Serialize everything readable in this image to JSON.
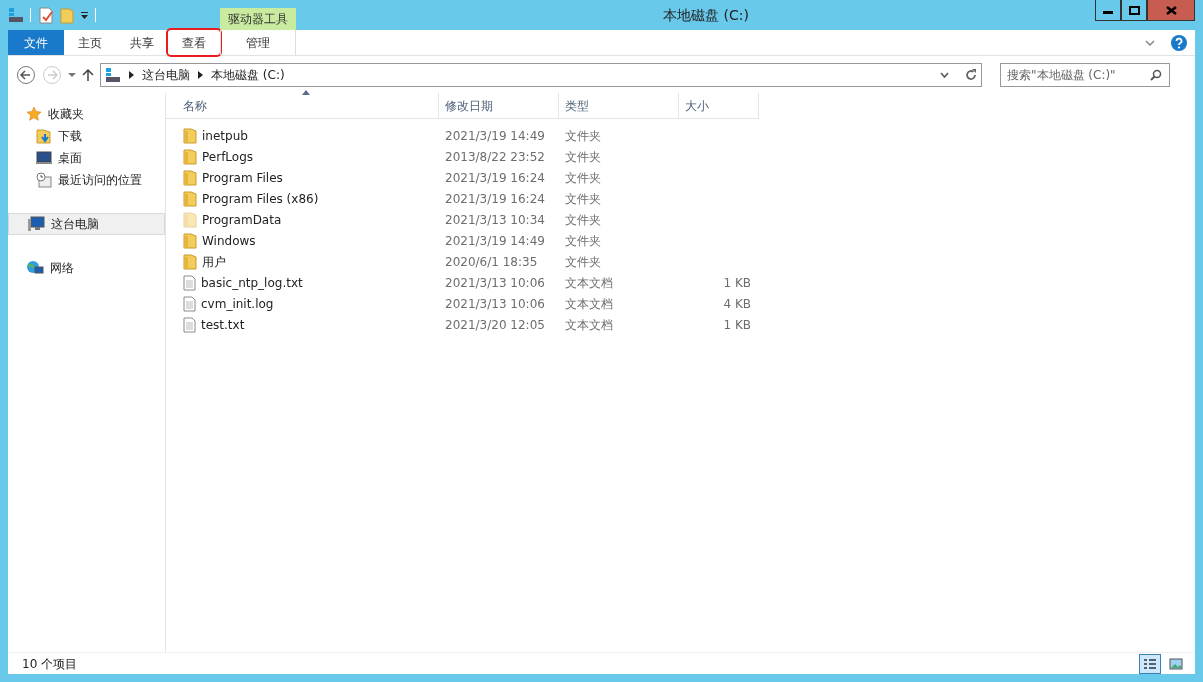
{
  "window": {
    "title": "本地磁盘 (C:)"
  },
  "ribbon": {
    "context_group": "驱动器工具",
    "tabs": [
      {
        "label": "文件",
        "kind": "file",
        "selected": false,
        "highlighted": false
      },
      {
        "label": "主页",
        "kind": "tab",
        "selected": false,
        "highlighted": false
      },
      {
        "label": "共享",
        "kind": "tab",
        "selected": false,
        "highlighted": false
      },
      {
        "label": "查看",
        "kind": "tab",
        "selected": false,
        "highlighted": true
      },
      {
        "label": "管理",
        "kind": "context",
        "selected": false,
        "highlighted": false
      }
    ]
  },
  "address": {
    "breadcrumbs": [
      "这台电脑",
      "本地磁盘 (C:)"
    ]
  },
  "search": {
    "placeholder": "搜索\"本地磁盘 (C:)\""
  },
  "sidebar": {
    "groups": [
      {
        "label": "收藏夹",
        "kind": "star",
        "selected": false,
        "children": [
          {
            "label": "下载",
            "kind": "download"
          },
          {
            "label": "桌面",
            "kind": "desktop"
          },
          {
            "label": "最近访问的位置",
            "kind": "recent"
          }
        ]
      },
      {
        "label": "这台电脑",
        "kind": "computer",
        "selected": true
      },
      {
        "label": "网络",
        "kind": "network",
        "selected": false
      }
    ]
  },
  "table": {
    "columns": [
      {
        "label": "名称",
        "sorted": true
      },
      {
        "label": "修改日期",
        "sorted": false
      },
      {
        "label": "类型",
        "sorted": false
      },
      {
        "label": "大小",
        "sorted": false
      }
    ],
    "rows": [
      {
        "kind": "folder",
        "hidden": false,
        "name": "inetpub",
        "date": "2021/3/19 14:49",
        "type": "文件夹"
      },
      {
        "kind": "folder",
        "hidden": false,
        "name": "PerfLogs",
        "date": "2013/8/22 23:52",
        "type": "文件夹"
      },
      {
        "kind": "folder",
        "hidden": false,
        "name": "Program Files",
        "date": "2021/3/19 16:24",
        "type": "文件夹"
      },
      {
        "kind": "folder",
        "hidden": false,
        "name": "Program Files (x86)",
        "date": "2021/3/19 16:24",
        "type": "文件夹"
      },
      {
        "kind": "folder",
        "hidden": true,
        "name": "ProgramData",
        "date": "2021/3/13 10:34",
        "type": "文件夹"
      },
      {
        "kind": "folder",
        "hidden": false,
        "name": "Windows",
        "date": "2021/3/19 14:49",
        "type": "文件夹"
      },
      {
        "kind": "folder",
        "hidden": false,
        "name": "用户",
        "date": "2020/6/1 18:35",
        "type": "文件夹"
      },
      {
        "kind": "file",
        "hidden": false,
        "name": "basic_ntp_log.txt",
        "date": "2021/3/13 10:06",
        "type": "文本文档",
        "size": "1 KB"
      },
      {
        "kind": "file",
        "hidden": false,
        "name": "cvm_init.log",
        "date": "2021/3/13 10:06",
        "type": "文本文档",
        "size": "4 KB"
      },
      {
        "kind": "file",
        "hidden": false,
        "name": "test.txt",
        "date": "2021/3/20 12:05",
        "type": "文本文档",
        "size": "1 KB"
      }
    ]
  },
  "status_bar": {
    "text": "10 个项目",
    "views": [
      {
        "kind": "details",
        "selected": true
      },
      {
        "kind": "tiles",
        "selected": false
      }
    ]
  }
}
